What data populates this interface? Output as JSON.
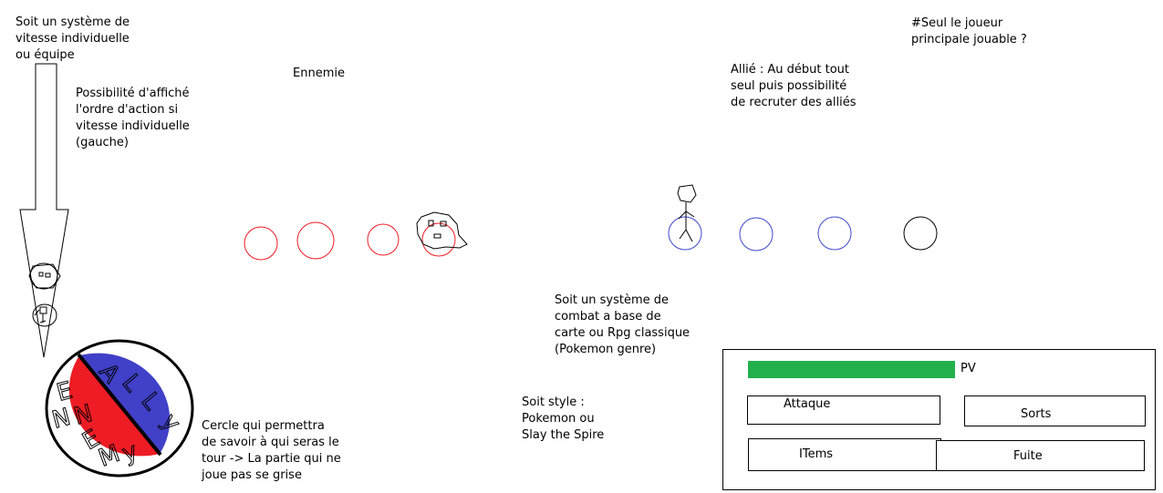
{
  "notes": {
    "speed_system": "Soit un système de\nvitesse individuelle\nou équipe",
    "action_order": "Possibilité d'affiché\nl'ordre d'action si\nvitesse individuelle\n(gauche)",
    "enemy_label": "Ennemie",
    "ally_note": "Allié : Au début tout\nseul puis possibilité\nde recruter des alliés",
    "main_player": "#Seul le joueur\nprincipale jouable ?",
    "combat_system": "Soit un système de\ncombat a base de\ncarte ou Rpg classique\n(Pokemon genre)",
    "style": "Soit style :\n Pokemon ou\nSlay the Spire",
    "turn_circle": "Cercle qui permettra\nde savoir à qui seras le\ntour -> La partie qui ne\njoue pas se grise"
  },
  "turn_circle": {
    "ally_letters": [
      "A",
      "L",
      "L",
      "y"
    ],
    "enemy_letters": [
      "E",
      "N",
      "N",
      "E",
      "M",
      "y"
    ],
    "ally_color": "#4040c8",
    "enemy_color": "#ee1c24"
  },
  "combat_ui": {
    "hp_label": "PV",
    "hp_fill": 1.0,
    "hp_color": "#22b14c",
    "buttons": {
      "attack": "Attaque",
      "spells": "Sorts",
      "items": "ITems",
      "flee": "Fuite"
    }
  },
  "colors": {
    "enemy_slot": "#ee1c24",
    "ally_slot": "#3f48cc",
    "player_slot": "#000000"
  }
}
